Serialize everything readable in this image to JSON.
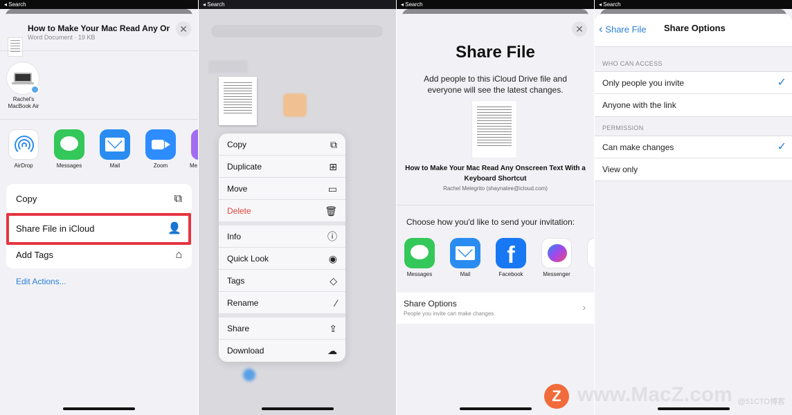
{
  "status": {
    "back_label": "◂ Search"
  },
  "share_sheet": {
    "doc_title": "How to Make Your Mac Read Any On...",
    "doc_subtitle": "Word Document · 19 KB",
    "close": "✕",
    "airdrop_person": "Rachel's MacBook Air",
    "apps": [
      {
        "label": "AirDrop",
        "icon": "airdrop-icon"
      },
      {
        "label": "Messages",
        "icon": "messages-icon"
      },
      {
        "label": "Mail",
        "icon": "mail-icon"
      },
      {
        "label": "Zoom",
        "icon": "zoom-icon"
      },
      {
        "label": "Me",
        "icon": "more-app-icon"
      }
    ],
    "actions": {
      "copy": "Copy",
      "share_icloud": "Share File in iCloud",
      "add_tags": "Add Tags",
      "edit_actions": "Edit Actions..."
    },
    "highlight_color": "#e53440"
  },
  "context_menu": {
    "items": [
      {
        "label": "Copy",
        "icon": "copy-icon"
      },
      {
        "label": "Duplicate",
        "icon": "duplicate-icon"
      },
      {
        "label": "Move",
        "icon": "folder-icon"
      },
      {
        "label": "Delete",
        "icon": "trash-icon"
      },
      {
        "label": "Info",
        "icon": "info-icon"
      },
      {
        "label": "Quick Look",
        "icon": "eye-icon"
      },
      {
        "label": "Tags",
        "icon": "tag-icon"
      },
      {
        "label": "Rename",
        "icon": "pencil-icon"
      },
      {
        "label": "Share",
        "icon": "share-icon"
      },
      {
        "label": "Download",
        "icon": "download-icon"
      }
    ],
    "delete_color": "#e5443b"
  },
  "share_file": {
    "title": "Share File",
    "description": "Add people to this iCloud Drive file and everyone will see the latest changes.",
    "doc_title": "How to Make Your Mac Read Any Onscreen Text With a Keyboard Shortcut",
    "owner": "Rachel Melegrito (shaynatee@icloud.com)",
    "choose": "Choose how you'd like to send your invitation:",
    "apps": [
      {
        "label": "Messages",
        "icon": "messages-icon"
      },
      {
        "label": "Mail",
        "icon": "mail-icon"
      },
      {
        "label": "Facebook",
        "icon": "facebook-icon"
      },
      {
        "label": "Messenger",
        "icon": "messenger-icon"
      }
    ],
    "share_options_title": "Share Options",
    "share_options_sub": "People you invite can make changes."
  },
  "share_options": {
    "back": "Share File",
    "title": "Share Options",
    "who_header": "WHO CAN ACCESS",
    "who_options": [
      {
        "label": "Only people you invite",
        "checked": true
      },
      {
        "label": "Anyone with the link",
        "checked": false
      }
    ],
    "perm_header": "PERMISSION",
    "perm_options": [
      {
        "label": "Can make changes",
        "checked": true
      },
      {
        "label": "View only",
        "checked": false
      }
    ],
    "check_mark": "✓",
    "accent": "#2a7fd6"
  },
  "watermark": {
    "logo": "Z",
    "text": "www.MacZ.com",
    "small": "@51CTO博客"
  }
}
